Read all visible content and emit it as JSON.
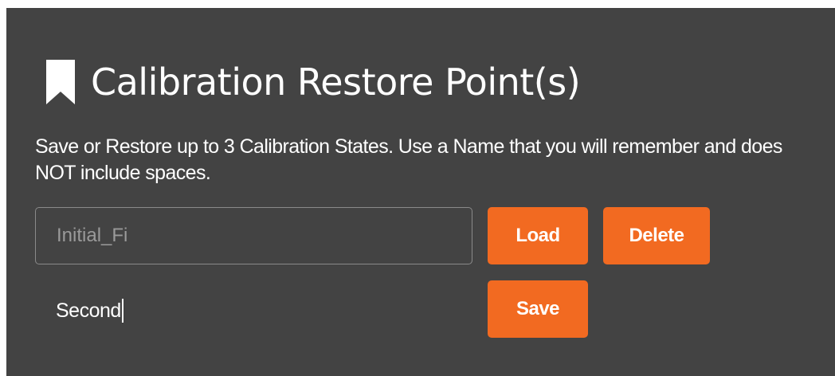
{
  "panel": {
    "title": "Calibration Restore Point(s)",
    "title_icon": "bookmark-icon",
    "description": "Save or Restore up to 3 Calibration States. Use a Name that you will remember and does NOT include spaces."
  },
  "restore_input": {
    "value": "",
    "placeholder": "Initial_Fi"
  },
  "new_name": {
    "value": "Second"
  },
  "buttons": {
    "load_label": "Load",
    "delete_label": "Delete",
    "save_label": "Save"
  },
  "colors": {
    "panel_background": "#434343",
    "button_accent": "#f26a21",
    "text": "#ffffff",
    "placeholder_text": "#9a9a9a"
  }
}
